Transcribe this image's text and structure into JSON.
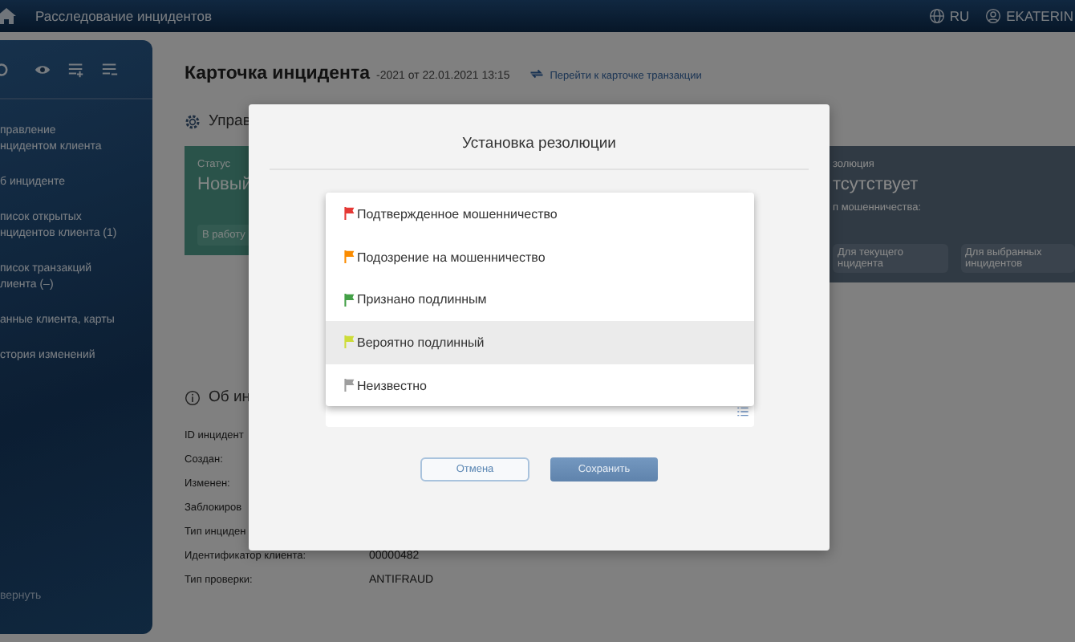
{
  "topbar": {
    "title": "Расследование инцидентов",
    "language": "RU",
    "user": "EKATERIN"
  },
  "sidebar": {
    "items": [
      {
        "lines": [
          "правление",
          "нцидентом клиента"
        ]
      },
      {
        "lines": [
          "б инциденте"
        ]
      },
      {
        "lines": [
          "писок открытых",
          "нцидентов клиента (1)"
        ]
      },
      {
        "lines": [
          "писок транзакций",
          "лиента (–)"
        ]
      },
      {
        "lines": [
          "анные клиента, карты"
        ]
      },
      {
        "lines": [
          "стория изменений"
        ]
      }
    ],
    "collapse": "вернуть"
  },
  "page": {
    "title": "Карточка инцидента",
    "subtitle": "-2021 от 22.01.2021 13:15",
    "transaction_link": "Перейти к карточке транзакции"
  },
  "management": {
    "heading": "Управ",
    "status_label": "Статус",
    "status": "Новый",
    "take_button": "В работу",
    "resolution_label": "золюция",
    "resolution": "тсутствует",
    "fraud_type_label": "п мошенничества:",
    "buttons": [
      {
        "lines": [
          "Для текущего",
          "нцидента"
        ]
      },
      {
        "lines": [
          "Для выбранных",
          "инцидентов"
        ]
      }
    ]
  },
  "info": {
    "heading": "Об ин",
    "fields": [
      {
        "label": "ID инцидент"
      },
      {
        "label": "Создан:"
      },
      {
        "label": "Изменен:"
      },
      {
        "label": "Заблокиров"
      },
      {
        "label": "Тип инциден"
      },
      {
        "label": "Идентификатор клиента:",
        "value": "00000482"
      },
      {
        "label": "Тип проверки:",
        "value": "ANTIFRAUD"
      }
    ]
  },
  "dialog": {
    "title": "Установка резолюции",
    "options": [
      {
        "label": "Подтвержденное мошенничество",
        "color": "#e53935",
        "selected": false
      },
      {
        "label": "Подозрение на мошенничество",
        "color": "#fb8c00",
        "selected": false
      },
      {
        "label": "Признано подлинным",
        "color": "#43a047",
        "selected": false
      },
      {
        "label": "Вероятно подлинный",
        "color": "#cddc39",
        "selected": true
      },
      {
        "label": "Неизвестно",
        "color": "#9e9e9e",
        "selected": false
      }
    ],
    "cancel": "Отмена",
    "save": "Сохранить"
  }
}
